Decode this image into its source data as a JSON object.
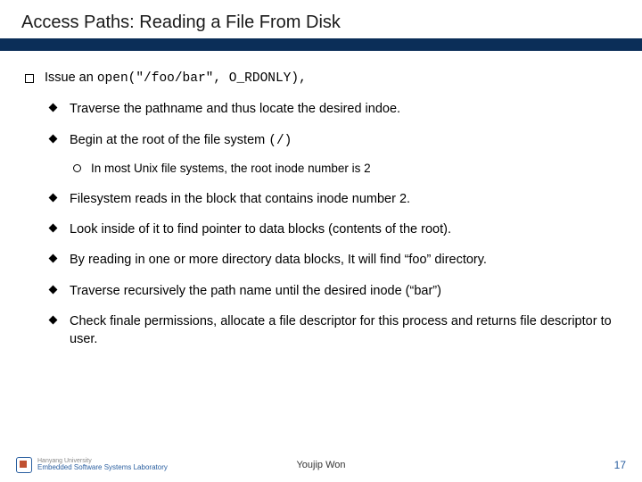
{
  "title": "Access Paths: Reading a File From Disk",
  "issue": {
    "prefix": "Issue an ",
    "code": "open(\"/foo/bar\", O_RDONLY),"
  },
  "bullets": {
    "b1": "Traverse the pathname and thus locate the desired indoe.",
    "b2_pre": "Begin at the root of the file system ",
    "b2_code": "(/)",
    "b2_sub": "In most Unix file systems, the root inode number is 2",
    "b3": "Filesystem reads in the block that contains inode number 2.",
    "b4": "Look inside of it to find pointer to data blocks (contents of the root).",
    "b5": "By reading in one or more directory data blocks, It will find “foo” directory.",
    "b6": "Traverse recursively the path name until the desired inode  (“bar”)",
    "b7": "Check finale permissions, allocate a file descriptor for this process  and returns file descriptor to user."
  },
  "footer": {
    "org_line1": "Hanyang University",
    "org_line2": "Embedded Software Systems Laboratory",
    "author": "Youjip Won",
    "page": "17"
  }
}
